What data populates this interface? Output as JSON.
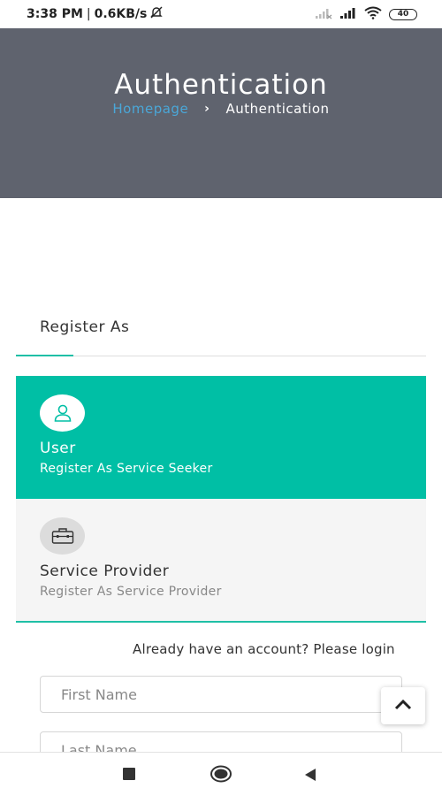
{
  "status_bar": {
    "time": "3:38 PM",
    "separator": "|",
    "speed": "0.6KB/s",
    "battery": "40"
  },
  "header": {
    "title": "Authentication",
    "breadcrumb": {
      "home": "Homepage",
      "separator": "›",
      "current": "Authentication"
    }
  },
  "register": {
    "tab_label": "Register As",
    "options": [
      {
        "title": "User",
        "subtitle": "Register As Service Seeker",
        "icon": "person-icon",
        "selected": true
      },
      {
        "title": "Service Provider",
        "subtitle": "Register As Service Provider",
        "icon": "briefcase-icon",
        "selected": false
      }
    ]
  },
  "login_prompt": "Already have an account? Please login",
  "form": {
    "first_name_placeholder": "First Name",
    "last_name_placeholder": "Last Name"
  },
  "colors": {
    "accent": "#00bfa5",
    "header_bg": "#5f636e",
    "link": "#4aa7d8"
  }
}
